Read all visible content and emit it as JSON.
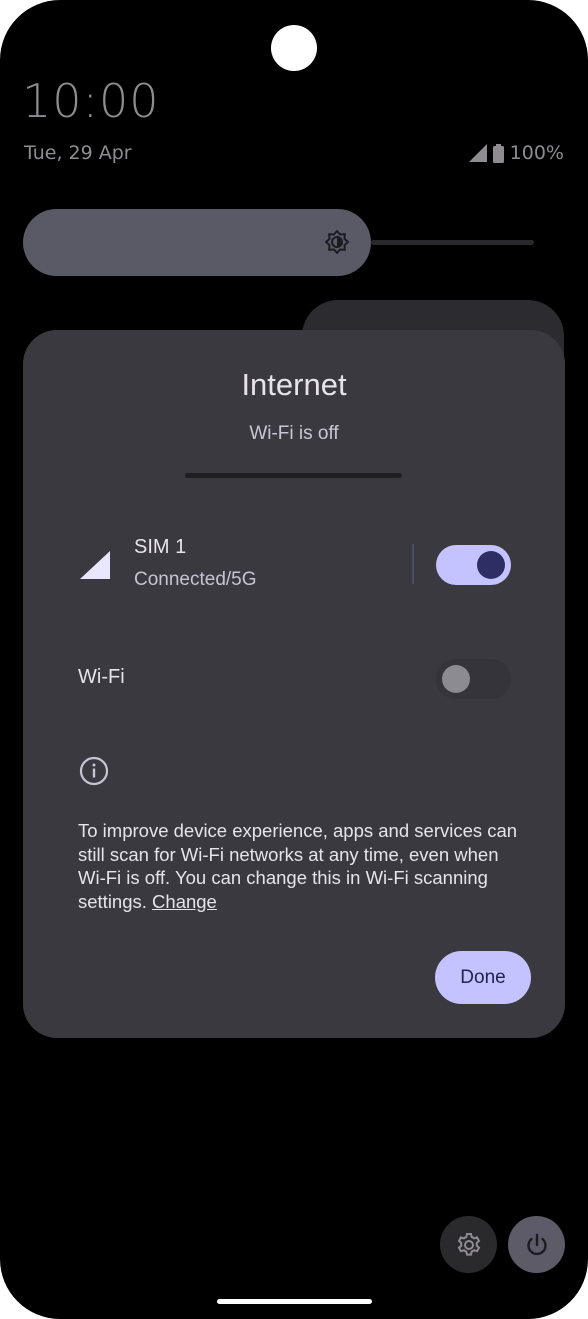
{
  "status_bar": {
    "time": "10:00",
    "date": "Tue, 29 Apr",
    "battery": "100%"
  },
  "quick_settings": {
    "brightness_level": 0.6
  },
  "internet_dialog": {
    "title": "Internet",
    "subtitle": "Wi-Fi is off",
    "sim": {
      "name": "SIM 1",
      "status": "Connected/5G",
      "toggle_on": true
    },
    "wifi": {
      "label": "Wi-Fi",
      "toggle_on": false
    },
    "info_text": "To improve device experience, apps and services can still scan for Wi-Fi networks at any time, even when Wi-Fi is off. You can change this in Wi-Fi scanning settings.",
    "change_link": "Change",
    "done_label": "Done"
  },
  "colors": {
    "accent": "#c5c3ff",
    "dialog_bg": "#3a3940",
    "screen_bg": "#000000"
  },
  "icons": [
    "cellular-signal-icon",
    "battery-icon",
    "brightness-icon",
    "info-icon",
    "settings-gear-icon",
    "power-icon"
  ]
}
